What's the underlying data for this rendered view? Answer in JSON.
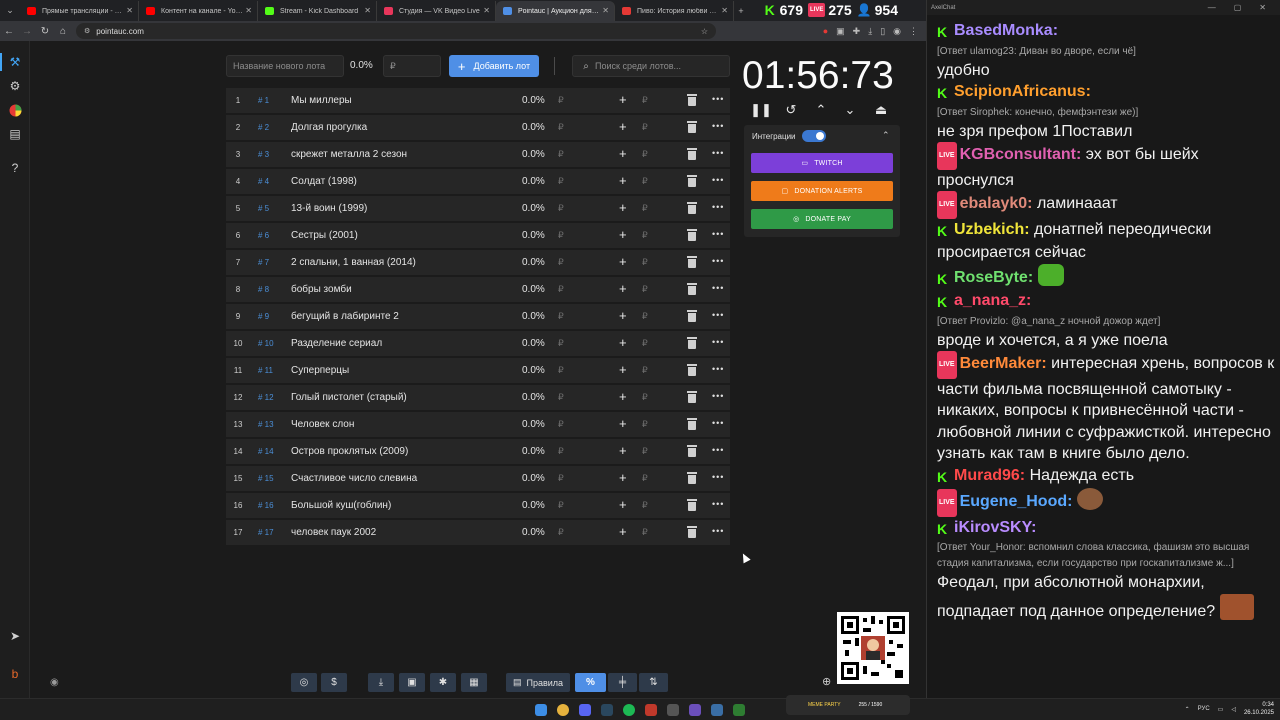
{
  "browser": {
    "tabs": [
      {
        "label": "Прямые трансляции - YouTube",
        "favicon_color": "#ff0000",
        "active": false
      },
      {
        "label": "Контент на канале - YouTube Studio",
        "favicon_color": "#ff0000",
        "active": false
      },
      {
        "label": "Stream - Kick Dashboard",
        "favicon_color": "#53fc18",
        "active": false
      },
      {
        "label": "Студия — VK Видео Live",
        "favicon_color": "#e8365b",
        "active": false
      },
      {
        "label": "Pointauc | Аукцион для стрима",
        "favicon_color": "#4f8fe6",
        "active": true
      },
      {
        "label": "Пиво: История любви фильм...",
        "favicon_color": "#e53935",
        "active": false
      }
    ],
    "url": "pointauc.com",
    "stream_stats": {
      "kick_viewers": "679",
      "vk_viewers": "275",
      "total_viewers": "954"
    }
  },
  "auction": {
    "new_lot_placeholder": "Название нового лота",
    "new_lot_percent": "0.0%",
    "amount_placeholder": "₽",
    "add_button_label": "Добавить лот",
    "search_placeholder": "Поиск среди лотов...",
    "currency_symbol": "₽",
    "lots": [
      {
        "num": "1",
        "id": "# 1",
        "name": "Мы миллеры",
        "percent": "0.0%"
      },
      {
        "num": "2",
        "id": "# 2",
        "name": "Долгая прогулка",
        "percent": "0.0%"
      },
      {
        "num": "3",
        "id": "# 3",
        "name": "скрежет металла 2 сезон",
        "percent": "0.0%"
      },
      {
        "num": "4",
        "id": "# 4",
        "name": "Солдат (1998)",
        "percent": "0.0%"
      },
      {
        "num": "5",
        "id": "# 5",
        "name": "13-й воин (1999)",
        "percent": "0.0%"
      },
      {
        "num": "6",
        "id": "# 6",
        "name": "Сестры (2001)",
        "percent": "0.0%"
      },
      {
        "num": "7",
        "id": "# 7",
        "name": "2 спальни, 1 ванная (2014)",
        "percent": "0.0%"
      },
      {
        "num": "8",
        "id": "# 8",
        "name": "бобры зомби",
        "percent": "0.0%"
      },
      {
        "num": "9",
        "id": "# 9",
        "name": "бегущий в лабиринте 2",
        "percent": "0.0%"
      },
      {
        "num": "10",
        "id": "# 10",
        "name": "Разделение сериал",
        "percent": "0.0%"
      },
      {
        "num": "11",
        "id": "# 11",
        "name": "Суперперцы",
        "percent": "0.0%"
      },
      {
        "num": "12",
        "id": "# 12",
        "name": "Голый пистолет (старый)",
        "percent": "0.0%"
      },
      {
        "num": "13",
        "id": "# 13",
        "name": "Человек слон",
        "percent": "0.0%"
      },
      {
        "num": "14",
        "id": "# 14",
        "name": "Остров проклятых (2009)",
        "percent": "0.0%"
      },
      {
        "num": "15",
        "id": "# 15",
        "name": "Счастливое число слевина",
        "percent": "0.0%"
      },
      {
        "num": "16",
        "id": "# 16",
        "name": "Большой куш(гоблин)",
        "percent": "0.0%"
      },
      {
        "num": "17",
        "id": "# 17",
        "name": "человек паук 2002",
        "percent": "0.0%"
      }
    ]
  },
  "timer": {
    "display": "01:56:73"
  },
  "integrations": {
    "label": "Интеграции",
    "enabled": true,
    "buttons": [
      {
        "label": "TWITCH",
        "color": "#7c3fd9"
      },
      {
        "label": "DONATION ALERTS",
        "color": "#ef7b1a"
      },
      {
        "label": "DONATE PAY",
        "color": "#2f9a47"
      }
    ]
  },
  "toolbar": {
    "rules_label": "Правила",
    "percent_label": "%"
  },
  "chat": {
    "window_title": "AxelChat",
    "messages": [
      {
        "platform": "kick",
        "user": "BasedMonka",
        "user_color": "#a98cff",
        "reply": "[Ответ ulamog23: Диван во дворе, если чё]",
        "text": "удобно",
        "emote": ""
      },
      {
        "platform": "kick",
        "user": "ScipionAfricanus",
        "user_color": "#ff9f2e",
        "reply": "[Ответ Sirophek: конечно, фемфэнтези же)]",
        "text": "не зря префом 1Поставил",
        "emote": ""
      },
      {
        "platform": "vk",
        "user": "KGBconsultant",
        "user_color": "#e060b0",
        "reply": "",
        "text": "эх вот бы шейх проснулся",
        "emote": ""
      },
      {
        "platform": "vk",
        "user": "ebalayk0",
        "user_color": "#e08a7a",
        "reply": "",
        "text": "ламинааат",
        "emote": ""
      },
      {
        "platform": "kick",
        "user": "Uzbekich",
        "user_color": "#f0e53a",
        "reply": "",
        "text": "донатпей переодически просирается сейчас",
        "emote": ""
      },
      {
        "platform": "kick",
        "user": "RoseByte",
        "user_color": "#6fe06f",
        "reply": "",
        "text": "",
        "emote": "green-frog"
      },
      {
        "platform": "kick",
        "user": "a_nana_z",
        "user_color": "#ff4a6a",
        "reply": "[Ответ Provizlo: @a_nana_z ночной дожор ждет]",
        "text": "вроде и хочется, а я уже поела",
        "emote": ""
      },
      {
        "platform": "vk",
        "user": "BeerMaker",
        "user_color": "#ff8a3a",
        "reply": "",
        "text": "интересная хрень, вопросов к части фильма посвященной самотыку - никаких, вопросы к привнесённой части - любовной линии с суфражисткой. интересно узнать как там в книге было дело.",
        "emote": ""
      },
      {
        "platform": "kick",
        "user": "Murad96",
        "user_color": "#ff4a4a",
        "reply": "",
        "text": "Надежда есть",
        "emote": ""
      },
      {
        "platform": "vk",
        "user": "Eugene_Hood",
        "user_color": "#5aa8ff",
        "reply": "",
        "text": "",
        "emote": "monkey"
      },
      {
        "platform": "kick",
        "user": "iKirovSKY",
        "user_color": "#b98cff",
        "reply": "[Ответ Your_Honor: вспомнил слова классика, фашизм это высшая стадия капитализма, если государство при госкапитализме ж...]",
        "text": "Феодал, при абсолютной монархии, подпадает под данное определение?",
        "emote": "face"
      }
    ]
  },
  "taskbar": {
    "language": "РУС",
    "time": "0:34",
    "date": "26.10.2025",
    "meme_widget": {
      "title": "MEME PARTY",
      "count": "255 / 1590"
    }
  }
}
